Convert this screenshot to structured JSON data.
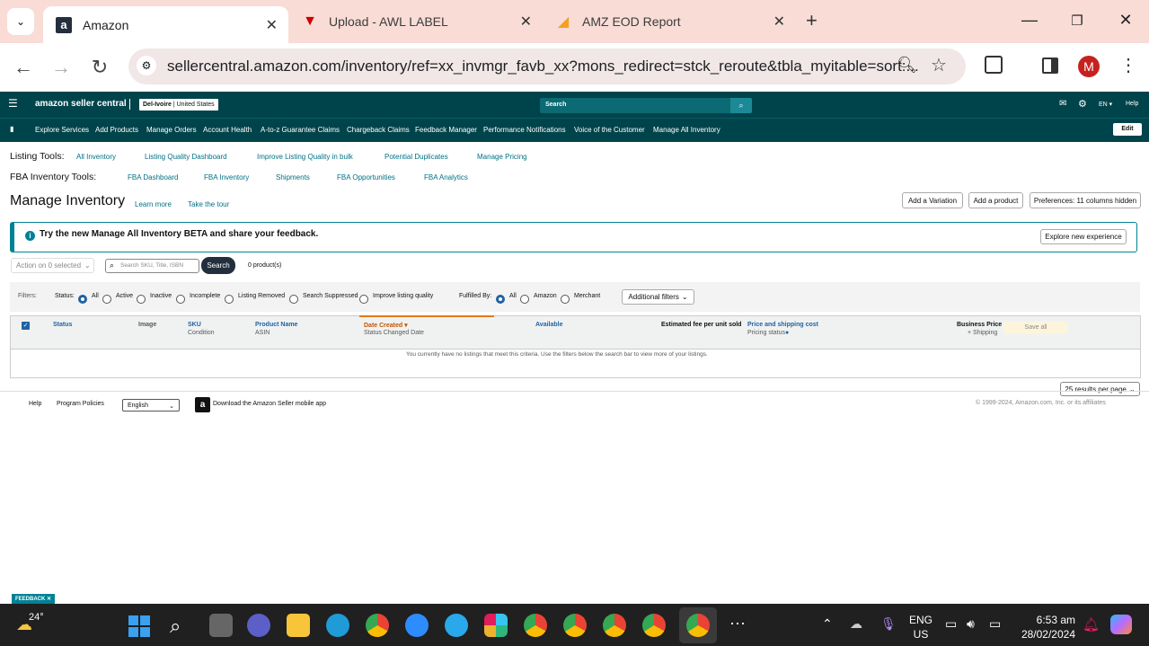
{
  "browser": {
    "tabs": [
      {
        "title": "Amazon",
        "active": true
      },
      {
        "title": "Upload - AWL LABEL",
        "active": false
      },
      {
        "title": "AMZ EOD Report",
        "active": false
      }
    ],
    "url": "sellercentral.amazon.com/inventory/ref=xx_invmgr_favb_xx?mons_redirect=stck_reroute&tbla_myitable=sort:...",
    "profile_initial": "M"
  },
  "header": {
    "logo": "amazon seller central",
    "store": "Del-Ivoire",
    "marketplace": "United States",
    "search_placeholder": "Search",
    "language": "EN",
    "help": "Help"
  },
  "nav": {
    "items": [
      "Explore Services",
      "Add Products",
      "Manage Orders",
      "Account Health",
      "A-to-z Guarantee Claims",
      "Chargeback Claims",
      "Feedback Manager",
      "Performance Notifications",
      "Voice of the Customer",
      "Manage All Inventory"
    ],
    "edit": "Edit"
  },
  "listing_tools": {
    "label": "Listing Tools:",
    "links": [
      "All Inventory",
      "Listing Quality Dashboard",
      "Improve Listing Quality in bulk",
      "Potential Duplicates",
      "Manage Pricing"
    ]
  },
  "fba_tools": {
    "label": "FBA Inventory Tools:",
    "links": [
      "FBA Dashboard",
      "FBA Inventory",
      "Shipments",
      "FBA Opportunities",
      "FBA Analytics"
    ]
  },
  "page": {
    "title": "Manage Inventory",
    "learn_more": "Learn more",
    "tour": "Take the tour",
    "add_variation": "Add a Variation",
    "add_product": "Add a product",
    "preferences": "Preferences: 11 columns hidden"
  },
  "banner": {
    "text": "Try the new Manage All Inventory BETA and share your feedback.",
    "button": "Explore new experience"
  },
  "search": {
    "action": "Action on 0 selected",
    "placeholder": "Search SKU, Title, ISBN",
    "button": "Search",
    "count": "0 product(s)"
  },
  "filters": {
    "label": "Filters:",
    "status_label": "Status:",
    "status_options": [
      "All",
      "Active",
      "Inactive",
      "Incomplete",
      "Listing Removed",
      "Search Suppressed",
      "Improve listing quality"
    ],
    "fulfilled_label": "Fulfilled By:",
    "fulfilled_options": [
      "All",
      "Amazon",
      "Merchant"
    ],
    "additional": "Additional filters"
  },
  "table": {
    "columns": {
      "status": "Status",
      "image": "Image",
      "sku": "SKU",
      "sku_sub": "Condition",
      "product": "Product Name",
      "product_sub": "ASIN",
      "date": "Date Created",
      "date_sub": "Status Changed Date",
      "available": "Available",
      "fee": "Estimated fee per unit sold",
      "price": "Price and shipping cost",
      "price_sub": "Pricing status",
      "business": "Business Price",
      "business_sub": "+ Shipping",
      "save_all": "Save all"
    },
    "empty": "You currently have no listings that meet this criteria. Use the filters below the search bar to view more of your listings.",
    "per_page": "25 results per page"
  },
  "footer": {
    "help": "Help",
    "policies": "Program Policies",
    "language": "English",
    "app": "Download the Amazon Seller mobile app",
    "copyright": "© 1999-2024, Amazon.com, Inc. or its affiliates",
    "feedback": "FEEDBACK"
  },
  "taskbar": {
    "weather": "24°",
    "lang1": "ENG",
    "lang2": "US",
    "time": "6:53 am",
    "date": "28/02/2024"
  }
}
